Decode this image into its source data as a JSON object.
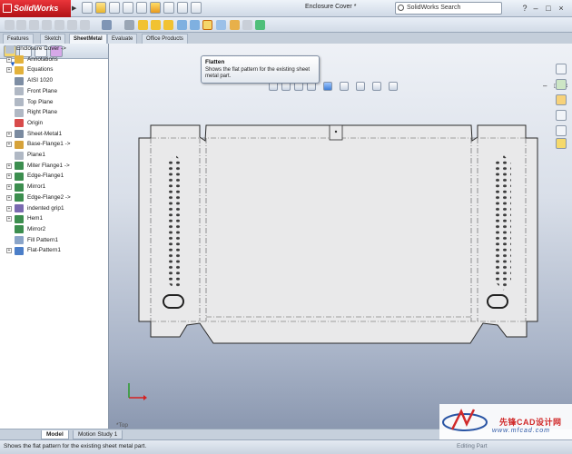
{
  "app": {
    "name": "SolidWorks",
    "doc_title": "Enclosure Cover *",
    "search_placeholder": "SolidWorks Search",
    "win_min": "–",
    "win_max": "□",
    "win_close": "×",
    "help": "?"
  },
  "command_tabs": [
    "Features",
    "Sketch",
    "SheetMetal",
    "Evaluate",
    "Office Products"
  ],
  "tooltip": {
    "title": "Flatten",
    "body": "Shows the flat pattern for the existing sheet metal part."
  },
  "tree": {
    "root": "Enclosure Cover ->",
    "items": [
      {
        "label": "Annotations",
        "expand": "+"
      },
      {
        "label": "Equations",
        "expand": "+"
      },
      {
        "label": "AISI 1020",
        "expand": ""
      },
      {
        "label": "Front Plane",
        "expand": ""
      },
      {
        "label": "Top Plane",
        "expand": ""
      },
      {
        "label": "Right Plane",
        "expand": ""
      },
      {
        "label": "Origin",
        "expand": ""
      },
      {
        "label": "Sheet-Metal1",
        "expand": "+"
      },
      {
        "label": "Base-Flange1 ->",
        "expand": "+"
      },
      {
        "label": "Plane1",
        "expand": ""
      },
      {
        "label": "Miter Flange1 ->",
        "expand": "+"
      },
      {
        "label": "Edge-Flange1",
        "expand": "+"
      },
      {
        "label": "Mirror1",
        "expand": "+"
      },
      {
        "label": "Edge-Flange2 ->",
        "expand": "+"
      },
      {
        "label": "indented grip1",
        "expand": "+"
      },
      {
        "label": "Hem1",
        "expand": "+"
      },
      {
        "label": "Mirror2",
        "expand": ""
      },
      {
        "label": "Fill Pattern1",
        "expand": ""
      },
      {
        "label": "Flat-Pattern1",
        "expand": "+"
      }
    ]
  },
  "bottom_tabs": [
    "Model",
    "Motion Study 1"
  ],
  "status": {
    "message": "Shows the flat pattern for the existing sheet metal part.",
    "editing": "Editing Part"
  },
  "view": {
    "triad_label": "*Top"
  },
  "watermark": {
    "chinese": "先锋CAD设计网",
    "url": "www.mfcad.com"
  },
  "colors": {
    "brand_red": "#c8191f",
    "part_fill": "#e8e8e8",
    "part_edge": "#333333"
  }
}
